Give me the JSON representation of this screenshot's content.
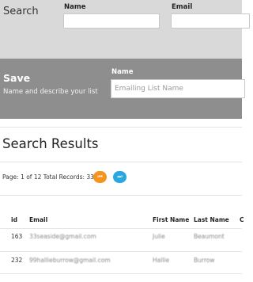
{
  "search": {
    "title": "Search",
    "name_label": "Name",
    "email_label": "Email",
    "name_value": "",
    "email_value": ""
  },
  "save": {
    "title": "Save",
    "description": "Name and describe your list",
    "name_label": "Name",
    "name_placeholder": "Emailing List Name"
  },
  "results": {
    "title": "Search Results",
    "pager_text": "Page: 1 of 12 Total Records: 335",
    "first_page_icon": "skip-back-icon",
    "last_page_icon": "skip-forward-icon",
    "first_color": "#f7941d",
    "last_color": "#29a8e0",
    "columns": [
      "id",
      "Email",
      "First Name",
      "Last Name",
      "C"
    ],
    "rows": [
      {
        "id": "163",
        "email": "33seaside@gmail.com",
        "first_name": "Julie",
        "last_name": "Beaumont"
      },
      {
        "id": "232",
        "email": "99hallieburrow@gmail.com",
        "first_name": "Hallie",
        "last_name": "Burrow"
      }
    ]
  }
}
